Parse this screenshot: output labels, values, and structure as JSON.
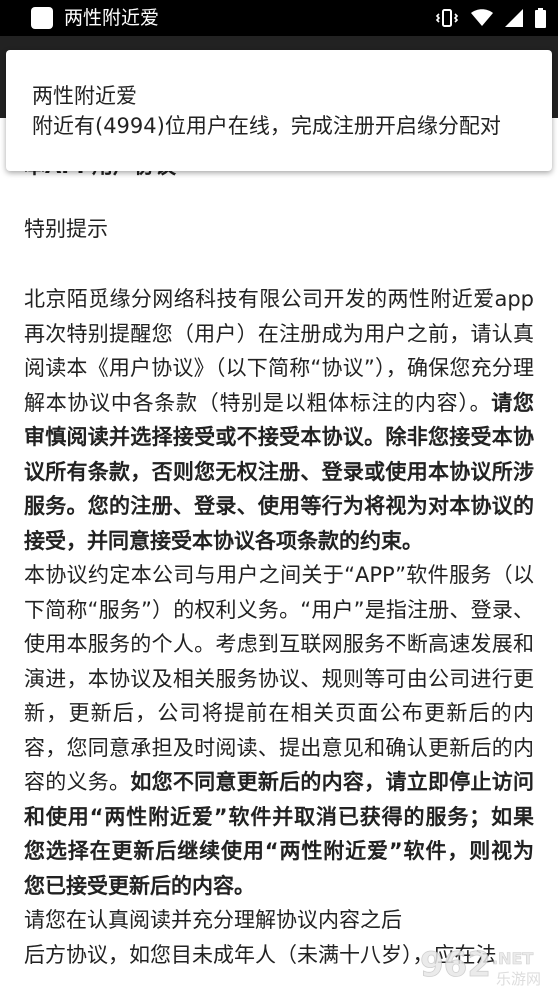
{
  "status_bar": {
    "app_title": "两性附近爱",
    "icons": [
      "app-icon",
      "vibrate-icon",
      "wifi-icon",
      "signal-icon",
      "battery-icon"
    ]
  },
  "notification": {
    "title": "两性附近爱",
    "text": "附近有(4994)位用户在线，完成注册开启缘分配对"
  },
  "document": {
    "title": "本APP用户协议",
    "section_heading": "特别提示",
    "para1_normal": "北京陌觅缘分网络科技有限公司开发的两性附近爱app再次特别提醒您（用户）在注册成为用户之前，请认真阅读本《用户协议》（以下简称“协议”），确保您充分理解本协议中各条款（特别是以粗体标注的内容）。",
    "para1_bold": "请您审慎阅读并选择接受或不接受本协议。除非您接受本协议所有条款，否则您无权注册、登录或使用本协议所涉服务。您的注册、登录、使用等行为将视为对本协议的接受，并同意接受本协议各项条款的约束。",
    "para2_normal": "本协议约定本公司与用户之间关于“APP”软件服务（以下简称“服务”）的权利义务。“用户”是指注册、登录、使用本服务的个人。考虑到互联网服务不断高速发展和演进，本协议及相关服务协议、规则等可由公司进行更新，更新后，公司将提前在相关页面公布更新后的内容，您同意承担及时阅读、提出意见和确认更新后的内容的义务。",
    "para2_bold": "如您不同意更新后的内容，请立即停止访问和使用“两性附近爱”软件并取消已获得的服务；如果您选择在更新后继续使用“两性附近爱”软件，则视为您已接受更新后的内容。",
    "para3_normal": "请您在认真阅读并充分理解协议内容之后",
    "para4": "后方协议，如您目未成年人（未满十八岁），应在法"
  },
  "watermark": {
    "text": "962",
    "suffix": ".NET",
    "sub": "乐游网"
  },
  "colors": {
    "status_bar_bg": "#000000",
    "app_bar_bg": "#222222",
    "text": "#222222",
    "notification_bg": "#ffffff"
  }
}
